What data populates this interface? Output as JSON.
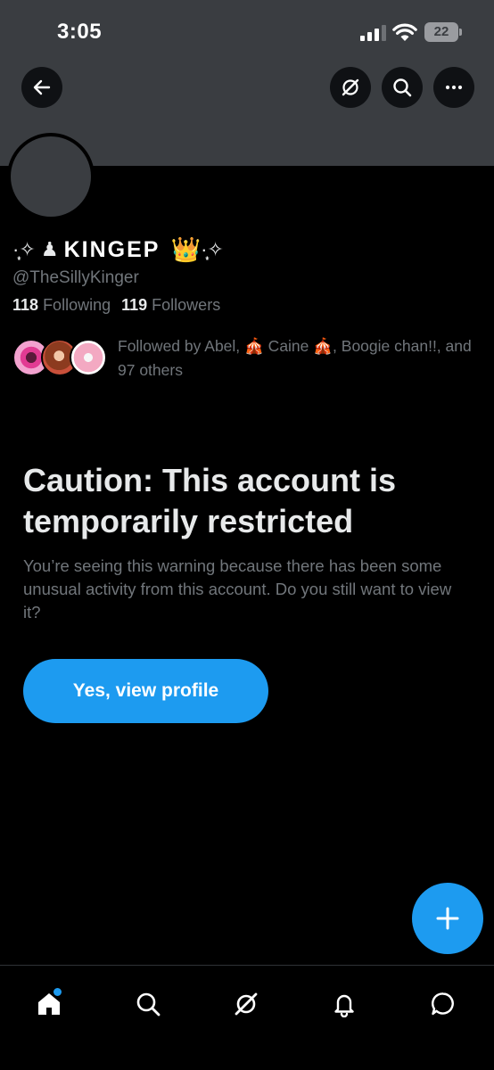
{
  "status_bar": {
    "time": "3:05",
    "battery": "22"
  },
  "header": {
    "back_icon": "arrow-left-icon",
    "grok_icon": "grok-icon",
    "search_icon": "search-icon",
    "more_icon": "more-horizontal-icon"
  },
  "profile": {
    "name_prefix": "·̩͙✧ ♟",
    "name_text": "KINGEP",
    "name_emoji": "👑",
    "name_suffix": "·̩͙✧",
    "handle": "@TheSillyKinger",
    "following_count": "118",
    "following_label": "Following",
    "followers_count": "119",
    "followers_label": "Followers",
    "followed_by": "Followed by Abel, 🎪 Caine 🎪, Boogie chan!!, and 97 others"
  },
  "warning": {
    "title": "Caution: This account is temporarily restricted",
    "body": "You’re seeing this warning because there has been some unusual activity from this account. Do you still want to view it?",
    "button_label": "Yes, view profile"
  },
  "bottom_nav": {
    "items": [
      "home-icon",
      "search-icon",
      "grok-icon",
      "notifications-icon",
      "messages-icon"
    ]
  },
  "colors": {
    "accent": "#1d9bf0",
    "background": "#000000",
    "banner": "#3a3d41",
    "muted_text": "#71767b"
  }
}
